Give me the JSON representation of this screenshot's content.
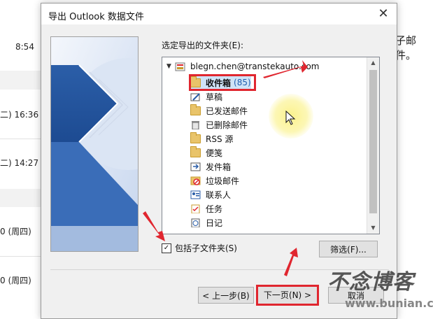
{
  "background": {
    "times": [
      "8:54",
      "二) 16:36",
      "二) 14:27",
      "0 (周四)",
      "0 (周四)"
    ],
    "side_text": "子邮件。"
  },
  "dialog": {
    "title": "导出 Outlook 数据文件",
    "close_glyph": "✕",
    "folder_label": "选定导出的文件夹(E):",
    "root_account": "blegn.chen@transtekauto.com",
    "folders": [
      {
        "label": "收件箱",
        "count": "(85)",
        "icon": "inbox-icon",
        "selected": true
      },
      {
        "label": "草稿",
        "icon": "drafts-icon"
      },
      {
        "label": "已发送邮件",
        "icon": "sent-icon"
      },
      {
        "label": "已删除邮件",
        "icon": "trash-icon"
      },
      {
        "label": "RSS 源",
        "icon": "folder-icon"
      },
      {
        "label": "便笺",
        "icon": "notes-icon"
      },
      {
        "label": "发件箱",
        "icon": "outbox-icon"
      },
      {
        "label": "垃圾邮件",
        "icon": "junk-icon"
      },
      {
        "label": "联系人",
        "icon": "contacts-icon"
      },
      {
        "label": "任务",
        "icon": "tasks-icon"
      },
      {
        "label": "日记",
        "icon": "journal-icon"
      }
    ],
    "include_subfolders": {
      "label": "包括子文件夹(S)",
      "checked": true
    },
    "filter_button": "筛选(F)...",
    "back_button": "< 上一步(B)",
    "next_button": "下一页(N) >",
    "cancel_button": "取消"
  },
  "watermark": {
    "main": "不念博客",
    "url": "www.bunian.cn"
  },
  "colors": {
    "highlight": "#e0262f",
    "selection": "#cfe3f7",
    "folder": "#e9c46a"
  }
}
